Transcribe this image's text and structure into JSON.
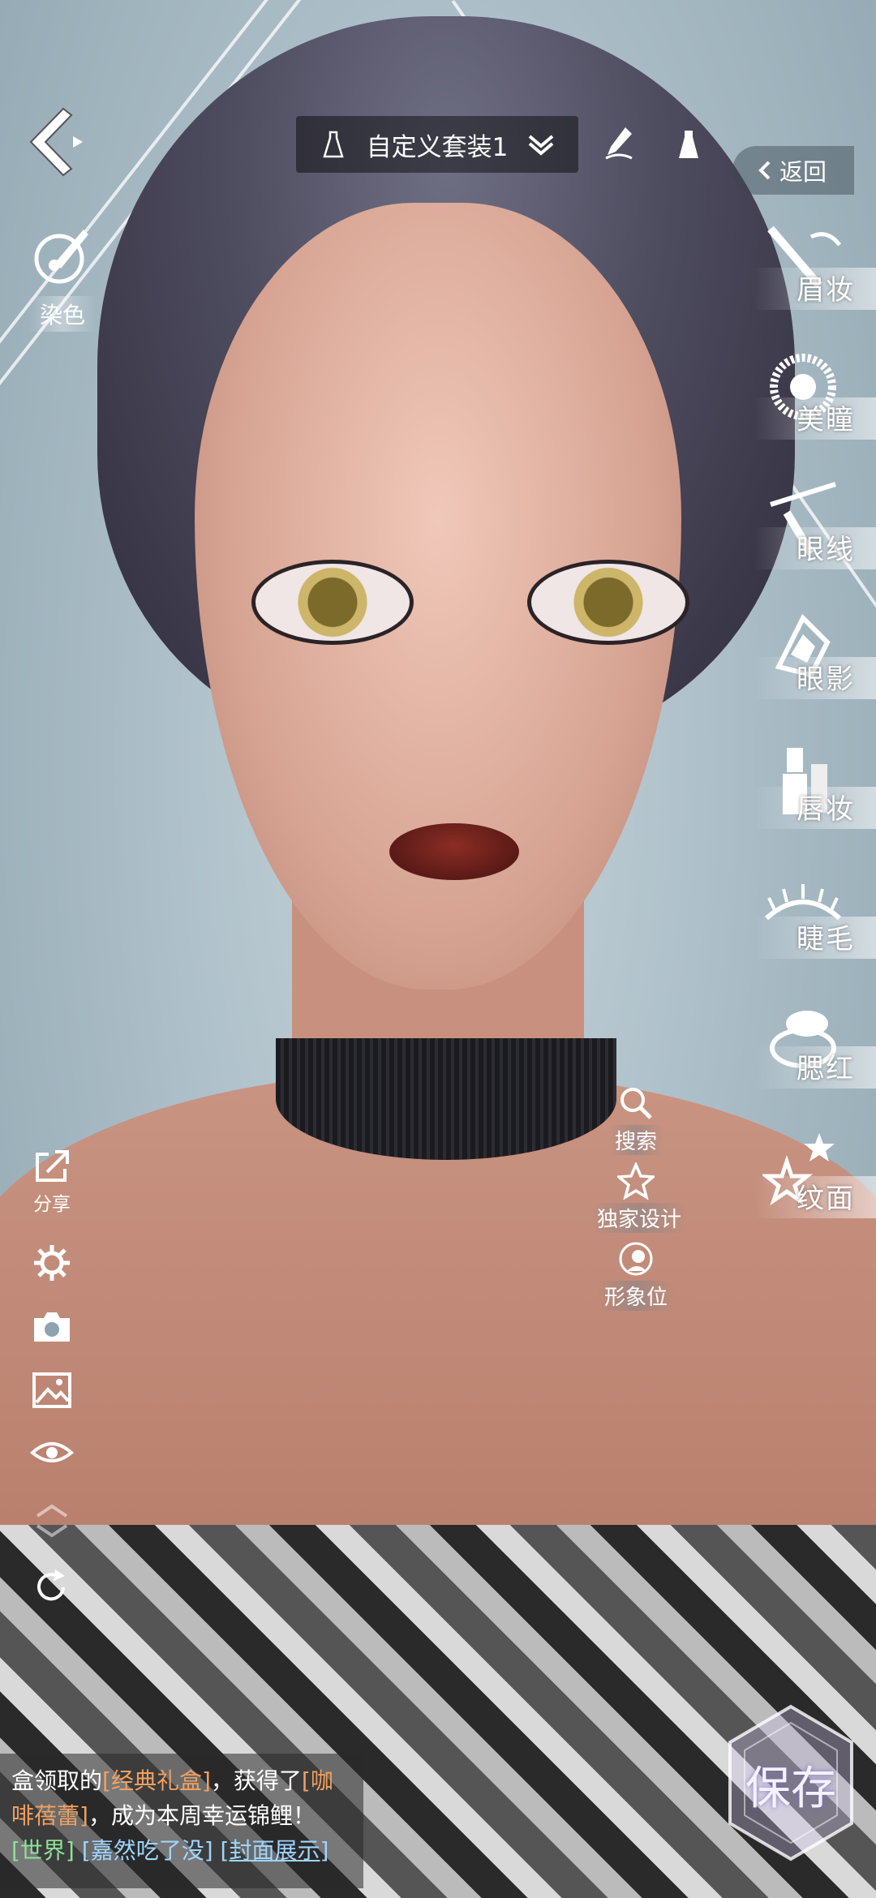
{
  "header": {
    "outfit_name": "自定义套装1",
    "return_label": "返回"
  },
  "dye": {
    "label": "染色"
  },
  "makeup_categories": [
    {
      "label": "眉妆",
      "icon": "eyebrow-pencil-icon"
    },
    {
      "label": "美瞳",
      "icon": "contact-lens-icon"
    },
    {
      "label": "眼线",
      "icon": "eyeliner-icon"
    },
    {
      "label": "眼影",
      "icon": "eyeshadow-icon"
    },
    {
      "label": "唇妆",
      "icon": "lipstick-icon"
    },
    {
      "label": "睫毛",
      "icon": "eyelash-icon"
    },
    {
      "label": "腮红",
      "icon": "blush-compact-icon"
    },
    {
      "label": "纹面",
      "icon": "star-tattoo-icon"
    }
  ],
  "middle_actions": [
    {
      "label": "搜索",
      "icon": "search-icon"
    },
    {
      "label": "独家设计",
      "icon": "star-icon"
    },
    {
      "label": "形象位",
      "icon": "portrait-slot-icon"
    }
  ],
  "left_tools": {
    "share_label": "分享"
  },
  "chat": {
    "line1_prefix": "盒领取的",
    "item1": "[经典礼盒]",
    "line1_mid": "，获得了",
    "item2a": "[咖",
    "item2b": "啡蓓蕾]",
    "line2_rest": "，成为本周幸运锦鲤！",
    "channel": "[世界]",
    "user": "[嘉然吃了没]",
    "link": "[封面展示]"
  },
  "save": {
    "label": "保存"
  }
}
